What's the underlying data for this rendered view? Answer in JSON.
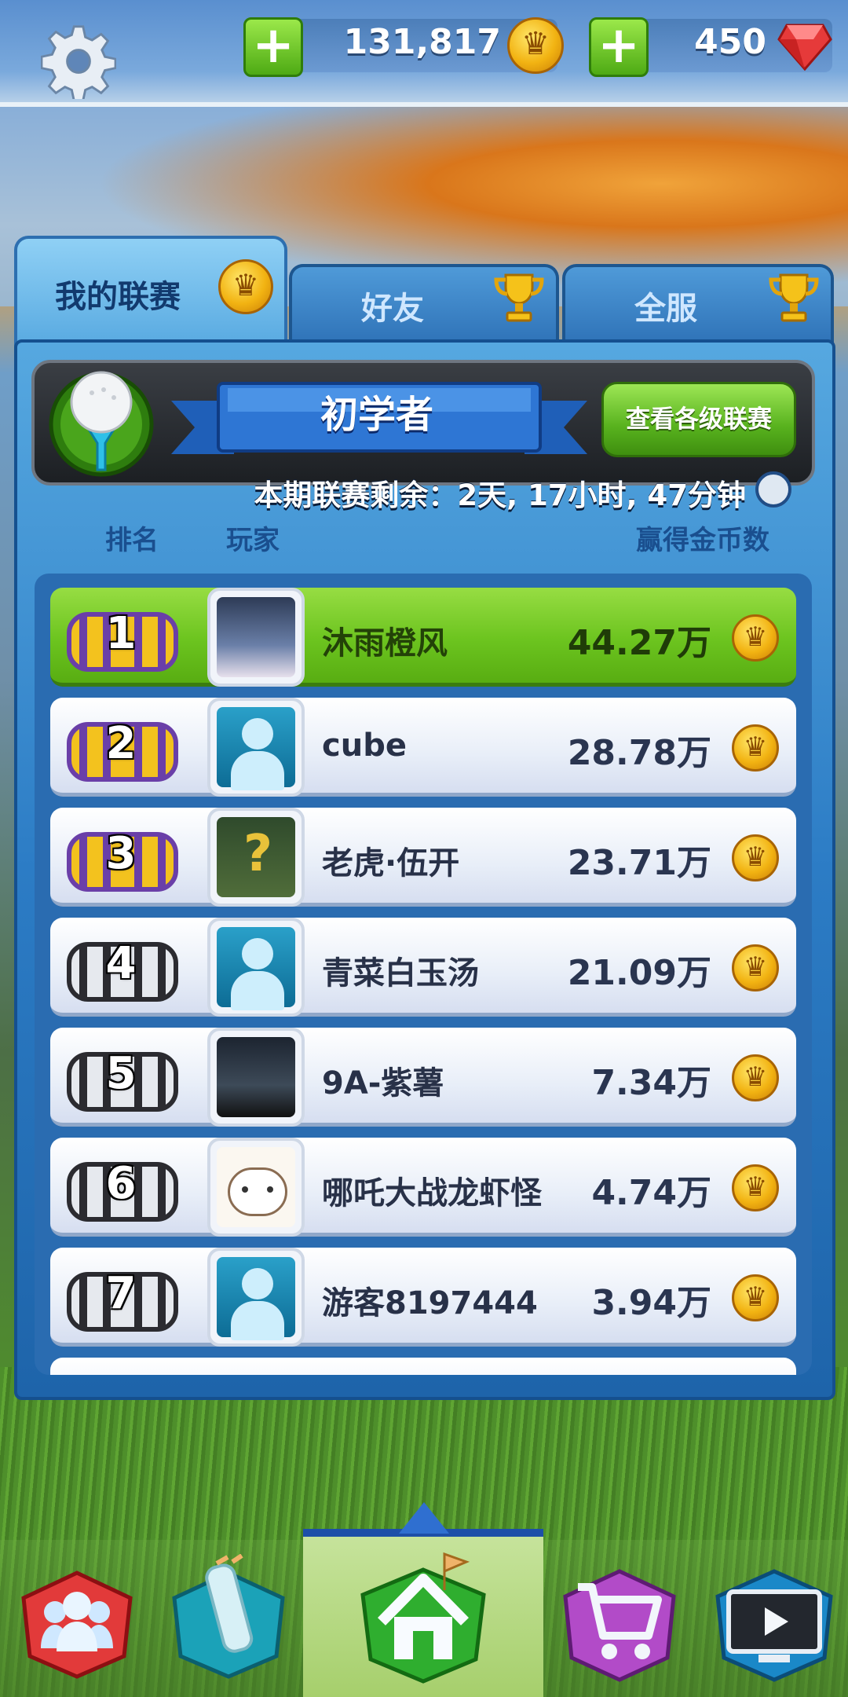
{
  "currency": {
    "coins": "131,817",
    "gems": "450",
    "add_coins_label": "+",
    "add_gems_label": "+"
  },
  "tabs": [
    {
      "label": "我的联赛",
      "icon": "crown-coin-icon",
      "active": true
    },
    {
      "label": "好友",
      "icon": "trophy-icon",
      "active": false
    },
    {
      "label": "全服",
      "icon": "trophy-icon",
      "active": false
    }
  ],
  "league": {
    "title": "初学者",
    "view_button": "查看各级联赛",
    "timer_text": "本期联赛剩余：2天, 17小时, 47分钟"
  },
  "headers": {
    "rank": "排名",
    "player": "玩家",
    "coins_won": "赢得金币数"
  },
  "leaderboard": [
    {
      "rank": "1",
      "name": "沐雨橙风",
      "score": "44.27万",
      "chest": "gold",
      "me": true
    },
    {
      "rank": "2",
      "name": "cube",
      "score": "28.78万",
      "chest": "gold",
      "me": false
    },
    {
      "rank": "3",
      "name": "老虎·伍开",
      "score": "23.71万",
      "chest": "gold",
      "me": false
    },
    {
      "rank": "4",
      "name": "青菜白玉汤",
      "score": "21.09万",
      "chest": "silver",
      "me": false
    },
    {
      "rank": "5",
      "name": "9A-紫薯",
      "score": "7.34万",
      "chest": "silver",
      "me": false
    },
    {
      "rank": "6",
      "name": "哪吒大战龙虾怪",
      "score": "4.74万",
      "chest": "silver",
      "me": false
    },
    {
      "rank": "7",
      "name": "游客8197444",
      "score": "3.94万",
      "chest": "silver",
      "me": false
    }
  ],
  "bottom_nav": [
    {
      "icon": "players-icon",
      "active": false
    },
    {
      "icon": "golf-bag-icon",
      "active": false
    },
    {
      "icon": "home-icon",
      "active": true
    },
    {
      "icon": "shop-cart-icon",
      "active": false
    },
    {
      "icon": "video-replay-icon",
      "active": false
    }
  ],
  "colors": {
    "accent_green": "#6cc41f",
    "panel_blue": "#2c7cc5",
    "gold": "#f2b312"
  }
}
